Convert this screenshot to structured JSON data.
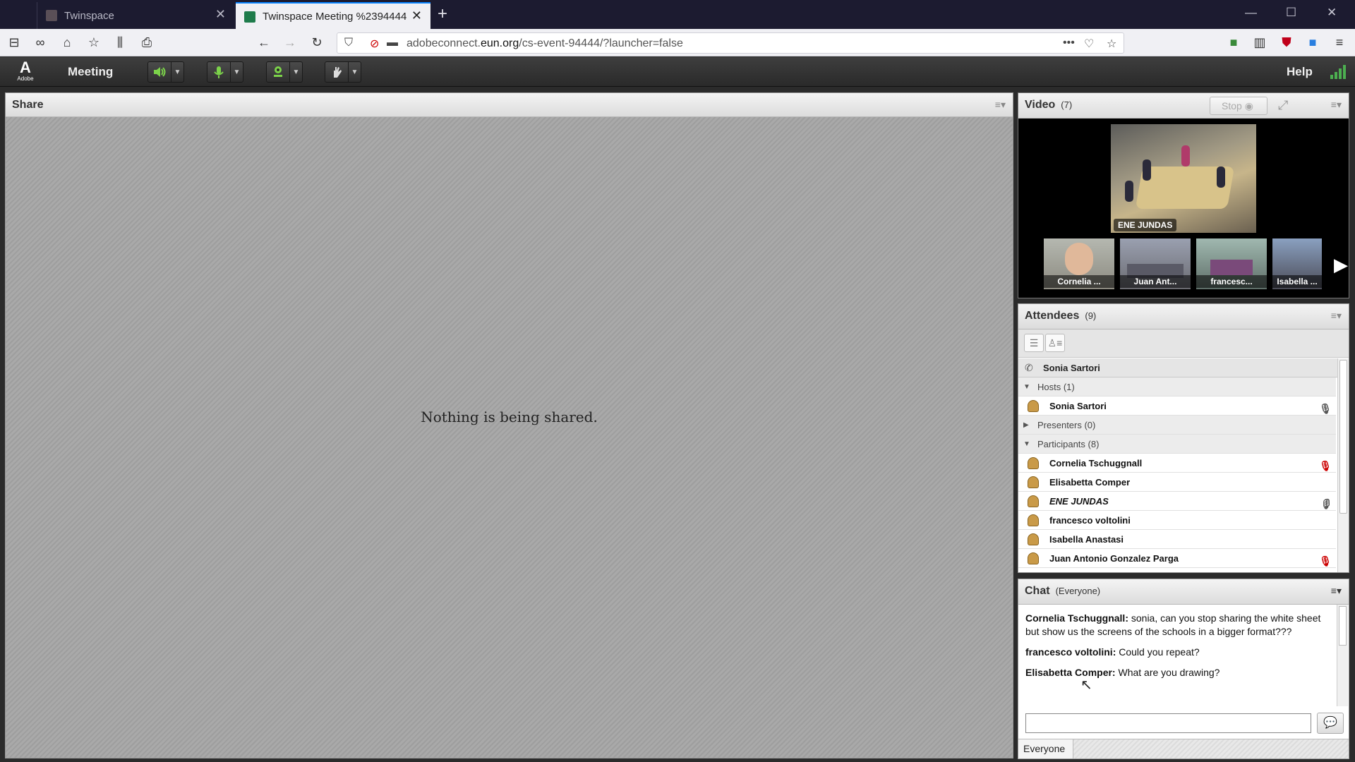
{
  "browser": {
    "tabs": [
      {
        "title": "Twinspace",
        "active": false
      },
      {
        "title": "Twinspace Meeting %2394444",
        "active": true
      }
    ],
    "url_prefix": "adobeconnect.",
    "url_domain": "eun.org",
    "url_path": "/cs-event-94444/?launcher=false"
  },
  "app": {
    "logo_letter": "A",
    "logo_text": "Adobe",
    "menu_meeting": "Meeting",
    "menu_help": "Help",
    "accent_green": "#4caf50"
  },
  "share": {
    "title": "Share",
    "empty_message": "Nothing is being shared."
  },
  "video": {
    "title": "Video",
    "count": "(7)",
    "stop_label": "Stop",
    "main_feed": "ENE JUNDAS",
    "thumbnails": [
      "Cornelia ...",
      "Juan Ant...",
      "francesc...",
      "Isabella ..."
    ]
  },
  "attendees": {
    "title": "Attendees",
    "count": "(9)",
    "speaker": "Sonia Sartori",
    "groups": {
      "hosts": "Hosts (1)",
      "presenters": "Presenters (0)",
      "participants": "Participants (8)"
    },
    "hosts": [
      {
        "name": "Sonia Sartori",
        "mic": "on"
      }
    ],
    "participants": [
      {
        "name": "Cornelia Tschuggnall",
        "mic": "muted"
      },
      {
        "name": "Elisabetta Comper",
        "mic": "none"
      },
      {
        "name": "ENE JUNDAS",
        "mic": "on"
      },
      {
        "name": "francesco voltolini",
        "mic": "none"
      },
      {
        "name": "Isabella Anastasi",
        "mic": "none"
      },
      {
        "name": "Juan Antonio Gonzalez Parga",
        "mic": "muted"
      }
    ]
  },
  "chat": {
    "title": "Chat",
    "scope": "(Everyone)",
    "messages": [
      {
        "sender": "Cornelia Tschuggnall:",
        "text": "sonia, can you stop sharing the white sheet but show us the screens of the schools in a bigger format???"
      },
      {
        "sender": "francesco voltolini:",
        "text": "Could you repeat?"
      },
      {
        "sender": "Elisabetta Comper:",
        "text": "What are you drawing?"
      }
    ],
    "input_value": "",
    "recipient": "Everyone"
  }
}
